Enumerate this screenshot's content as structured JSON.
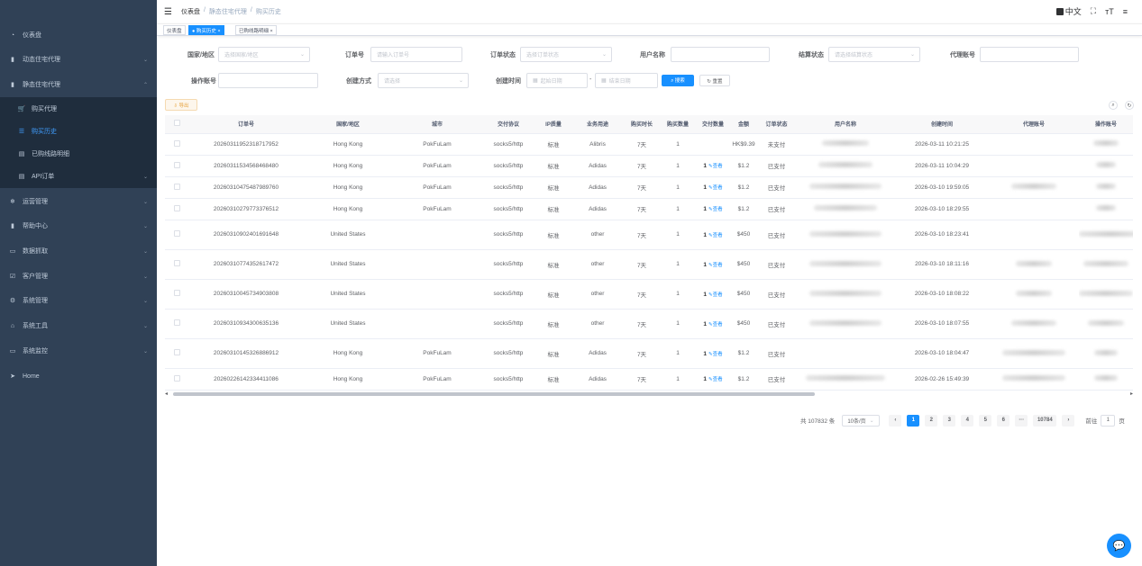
{
  "sidebar": {
    "items": [
      {
        "label": "仪表盘",
        "icon": "dashboard-icon",
        "glyph": "◔",
        "chev": "",
        "sub": false,
        "active": false
      },
      {
        "label": "动态住宅代理",
        "icon": "bar-chart-icon",
        "glyph": "▮",
        "chev": "⌄",
        "sub": false,
        "active": false
      },
      {
        "label": "静态住宅代理",
        "icon": "bar-chart-icon",
        "glyph": "▮",
        "chev": "⌃",
        "sub": false,
        "active": false
      },
      {
        "label": "购买代理",
        "icon": "cart-icon",
        "glyph": "🛒",
        "chev": "",
        "sub": true,
        "active": false
      },
      {
        "label": "购买历史",
        "icon": "list-icon",
        "glyph": "☰",
        "chev": "",
        "sub": true,
        "active": true
      },
      {
        "label": "已购线路明细",
        "icon": "table-icon",
        "glyph": "▤",
        "chev": "",
        "sub": true,
        "active": false
      },
      {
        "label": "API订单",
        "icon": "table-icon",
        "glyph": "▤",
        "chev": "⌄",
        "sub": true,
        "active": false
      },
      {
        "label": "运营管理",
        "icon": "tag-icon",
        "glyph": "❄",
        "chev": "⌄",
        "sub": false,
        "active": false
      },
      {
        "label": "帮助中心",
        "icon": "book-icon",
        "glyph": "▮",
        "chev": "⌄",
        "sub": false,
        "active": false
      },
      {
        "label": "数据抓取",
        "icon": "monitor-icon",
        "glyph": "▭",
        "chev": "⌄",
        "sub": false,
        "active": false
      },
      {
        "label": "客户管理",
        "icon": "checkbox-icon",
        "glyph": "☑",
        "chev": "⌄",
        "sub": false,
        "active": false
      },
      {
        "label": "系统管理",
        "icon": "gear-icon",
        "glyph": "⚙",
        "chev": "⌄",
        "sub": false,
        "active": false
      },
      {
        "label": "系统工具",
        "icon": "tool-icon",
        "glyph": "⌂",
        "chev": "⌄",
        "sub": false,
        "active": false
      },
      {
        "label": "系统监控",
        "icon": "monitor-icon",
        "glyph": "▭",
        "chev": "⌄",
        "sub": false,
        "active": false
      },
      {
        "label": "Home",
        "icon": "send-icon",
        "glyph": "➤",
        "chev": "",
        "sub": false,
        "active": false
      }
    ]
  },
  "navbar": {
    "hamburger": "☰",
    "breadcrumb": [
      "仪表盘",
      "/",
      "静态住宅代理",
      "/",
      "购买历史"
    ],
    "lang": "中文",
    "fullscreen": "⛶",
    "fontsize": "тT",
    "menu": "≡"
  },
  "tags": [
    {
      "label": "仪表盘",
      "active": false
    },
    {
      "label": "● 购买历史 ×",
      "active": true
    },
    {
      "label": "已购线路明细 ×",
      "active": false
    }
  ],
  "filters": {
    "row1": [
      {
        "label": "国家/地区",
        "placeholder": "选择国家/地区",
        "select": true
      },
      {
        "label": "订单号",
        "placeholder": "请输入订单号",
        "select": false
      },
      {
        "label": "订单状态",
        "placeholder": "选择订单状态",
        "select": true
      },
      {
        "label": "用户名称",
        "placeholder": "",
        "select": false
      },
      {
        "label": "结算状态",
        "placeholder": "请选择结算状态",
        "select": true
      },
      {
        "label": "代理账号",
        "placeholder": "",
        "select": false
      }
    ],
    "operator_label": "操作账号",
    "method_label": "创建方式",
    "method_placeholder": "请选择",
    "time_label": "创建时间",
    "start_placeholder": "起始日期",
    "dash": "-",
    "end_placeholder": "结束日期",
    "search_button": "⌕ 搜索",
    "reset_button": "↻ 重置",
    "export_button": "⇩ 导出",
    "search_toggle": "⌕",
    "refresh": "↻"
  },
  "table": {
    "headers": [
      "",
      "订单号",
      "国家/地区",
      "城市",
      "交付协议",
      "IP质量",
      "业务用途",
      "购买时长",
      "购买数量",
      "交付数量",
      "金额",
      "订单状态",
      "用户名称",
      "创建时间",
      "代理账号",
      "操作账号"
    ],
    "view_label": "查看",
    "rows": [
      {
        "order": "20260311952318717952",
        "country": "Hong Kong",
        "city": "PokFuLam",
        "proto": "socks5/http",
        "quality": "标准",
        "usage": "Alibris",
        "dur": "7天",
        "qty": "1",
        "deliv": "",
        "amount": "HK$9.39",
        "status": "未支付",
        "time": "2026-03-11 10:21:25"
      },
      {
        "order": "20260311534568468480",
        "country": "Hong Kong",
        "city": "PokFuLam",
        "proto": "socks5/http",
        "quality": "标准",
        "usage": "Adidas",
        "dur": "7天",
        "qty": "1",
        "deliv": "1",
        "amount": "$1.2",
        "status": "已支付",
        "time": "2026-03-11 10:04:29"
      },
      {
        "order": "20260310475487989760",
        "country": "Hong Kong",
        "city": "PokFuLam",
        "proto": "socks5/http",
        "quality": "标准",
        "usage": "Adidas",
        "dur": "7天",
        "qty": "1",
        "deliv": "1",
        "amount": "$1.2",
        "status": "已支付",
        "time": "2026-03-10 19:59:05"
      },
      {
        "order": "20260310279773376512",
        "country": "Hong Kong",
        "city": "PokFuLam",
        "proto": "socks5/http",
        "quality": "标准",
        "usage": "Adidas",
        "dur": "7天",
        "qty": "1",
        "deliv": "1",
        "amount": "$1.2",
        "status": "已支付",
        "time": "2026-03-10 18:29:55"
      },
      {
        "order": "20260310902401691648",
        "country": "United States",
        "city": "",
        "proto": "socks5/http",
        "quality": "标准",
        "usage": "other",
        "dur": "7天",
        "qty": "1",
        "deliv": "1",
        "amount": "$450",
        "status": "已支付",
        "time": "2026-03-10 18:23:41"
      },
      {
        "order": "20260310774352617472",
        "country": "United States",
        "city": "",
        "proto": "socks5/http",
        "quality": "标准",
        "usage": "other",
        "dur": "7天",
        "qty": "1",
        "deliv": "1",
        "amount": "$450",
        "status": "已支付",
        "time": "2026-03-10 18:11:16"
      },
      {
        "order": "20260310045734903808",
        "country": "United States",
        "city": "",
        "proto": "socks5/http",
        "quality": "标准",
        "usage": "other",
        "dur": "7天",
        "qty": "1",
        "deliv": "1",
        "amount": "$450",
        "status": "已支付",
        "time": "2026-03-10 18:08:22"
      },
      {
        "order": "20260310934300635136",
        "country": "United States",
        "city": "",
        "proto": "socks5/http",
        "quality": "标准",
        "usage": "other",
        "dur": "7天",
        "qty": "1",
        "deliv": "1",
        "amount": "$450",
        "status": "已支付",
        "time": "2026-03-10 18:07:55"
      },
      {
        "order": "20260310145326886912",
        "country": "Hong Kong",
        "city": "PokFuLam",
        "proto": "socks5/http",
        "quality": "标准",
        "usage": "Adidas",
        "dur": "7天",
        "qty": "1",
        "deliv": "1",
        "amount": "$1.2",
        "status": "已支付",
        "time": "2026-03-10 18:04:47"
      },
      {
        "order": "20260226142334411086",
        "country": "Hong Kong",
        "city": "PokFuLam",
        "proto": "socks5/http",
        "quality": "标准",
        "usage": "Adidas",
        "dur": "7天",
        "qty": "1",
        "deliv": "1",
        "amount": "$1.2",
        "status": "已支付",
        "time": "2026-02-26 15:49:39"
      }
    ]
  },
  "pagination": {
    "total": "共 107832 条",
    "page_size": "10条/页",
    "prev": "‹",
    "pages": [
      "1",
      "2",
      "3",
      "4",
      "5",
      "6",
      "···",
      "10784"
    ],
    "next": "›",
    "goto": "前往",
    "goto_value": "1",
    "page_unit": "页"
  },
  "scroll": {
    "left": "◂",
    "right": "▸"
  },
  "chat_icon": "💬"
}
